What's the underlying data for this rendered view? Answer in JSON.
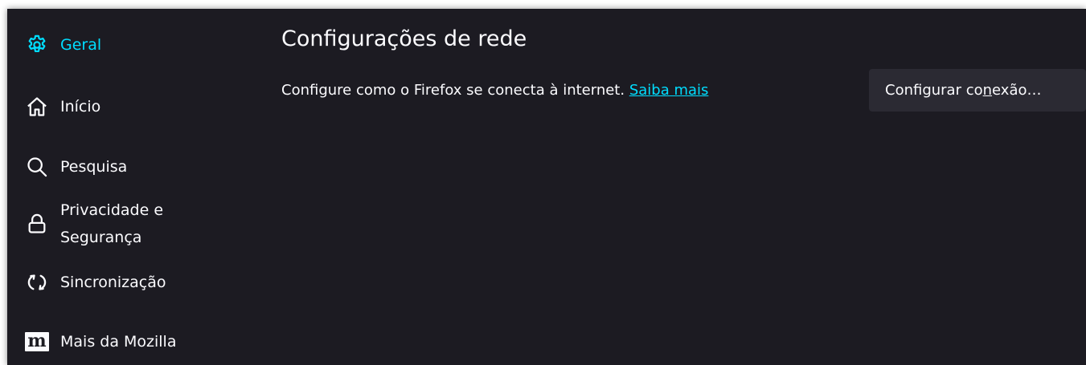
{
  "colors": {
    "background": "#1c1b22",
    "text": "#fbfbfe",
    "accent": "#00ddff",
    "button_bg": "#2b2a33"
  },
  "sidebar": {
    "items": [
      {
        "label": "Geral",
        "icon": "gear-icon",
        "active": true
      },
      {
        "label": "Início",
        "icon": "home-icon",
        "active": false
      },
      {
        "label": "Pesquisa",
        "icon": "search-icon",
        "active": false
      },
      {
        "label": "Privacidade e Segurança",
        "icon": "lock-icon",
        "active": false
      },
      {
        "label": "Sincronização",
        "icon": "sync-icon",
        "active": false
      },
      {
        "label": "Mais da Mozilla",
        "icon": "mozilla-icon",
        "active": false
      }
    ]
  },
  "network": {
    "title": "Configurações de rede",
    "description": "Configure como o Firefox se conecta à internet.",
    "learn_more": "Saiba mais",
    "button_pre": "Configurar co",
    "button_access_key": "n",
    "button_post": "exão…"
  }
}
